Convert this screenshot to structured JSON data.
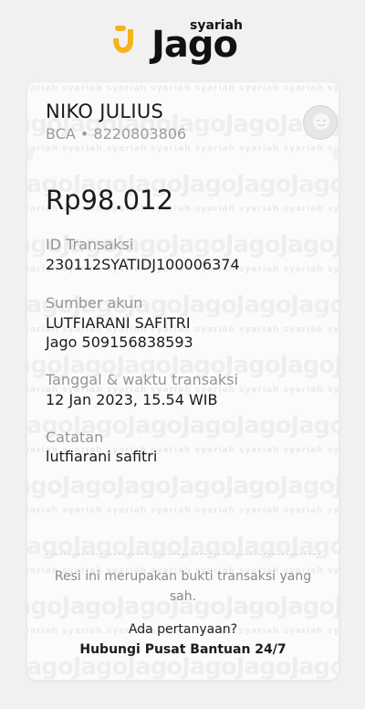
{
  "brand": {
    "logo_top": "syariah",
    "logo_main": "Jago",
    "accent_color": "#F5B21B"
  },
  "recipient": {
    "name": "NIKO JULIUS",
    "bank_account": "BCA • 8220803806",
    "avatar_icon": "person-avatar-icon"
  },
  "transaction": {
    "amount": "Rp98.012",
    "id_label": "ID Transaksi",
    "id_value": "230112SYATIDJ100006374",
    "source_label": "Sumber akun",
    "source_name": "LUTFIARANI SAFITRI",
    "source_account": "Jago 509156838593",
    "datetime_label": "Tanggal & waktu transaksi",
    "datetime_value": "12 Jan 2023, 15.54 WIB",
    "note_label": "Catatan",
    "note_value": "lutfiarani safitri"
  },
  "footer": {
    "receipt_note": "Resi ini merupakan bukti transaksi yang sah.",
    "question": "Ada pertanyaan?",
    "help_link": "Hubungi Pusat Bantuan 24/7"
  }
}
